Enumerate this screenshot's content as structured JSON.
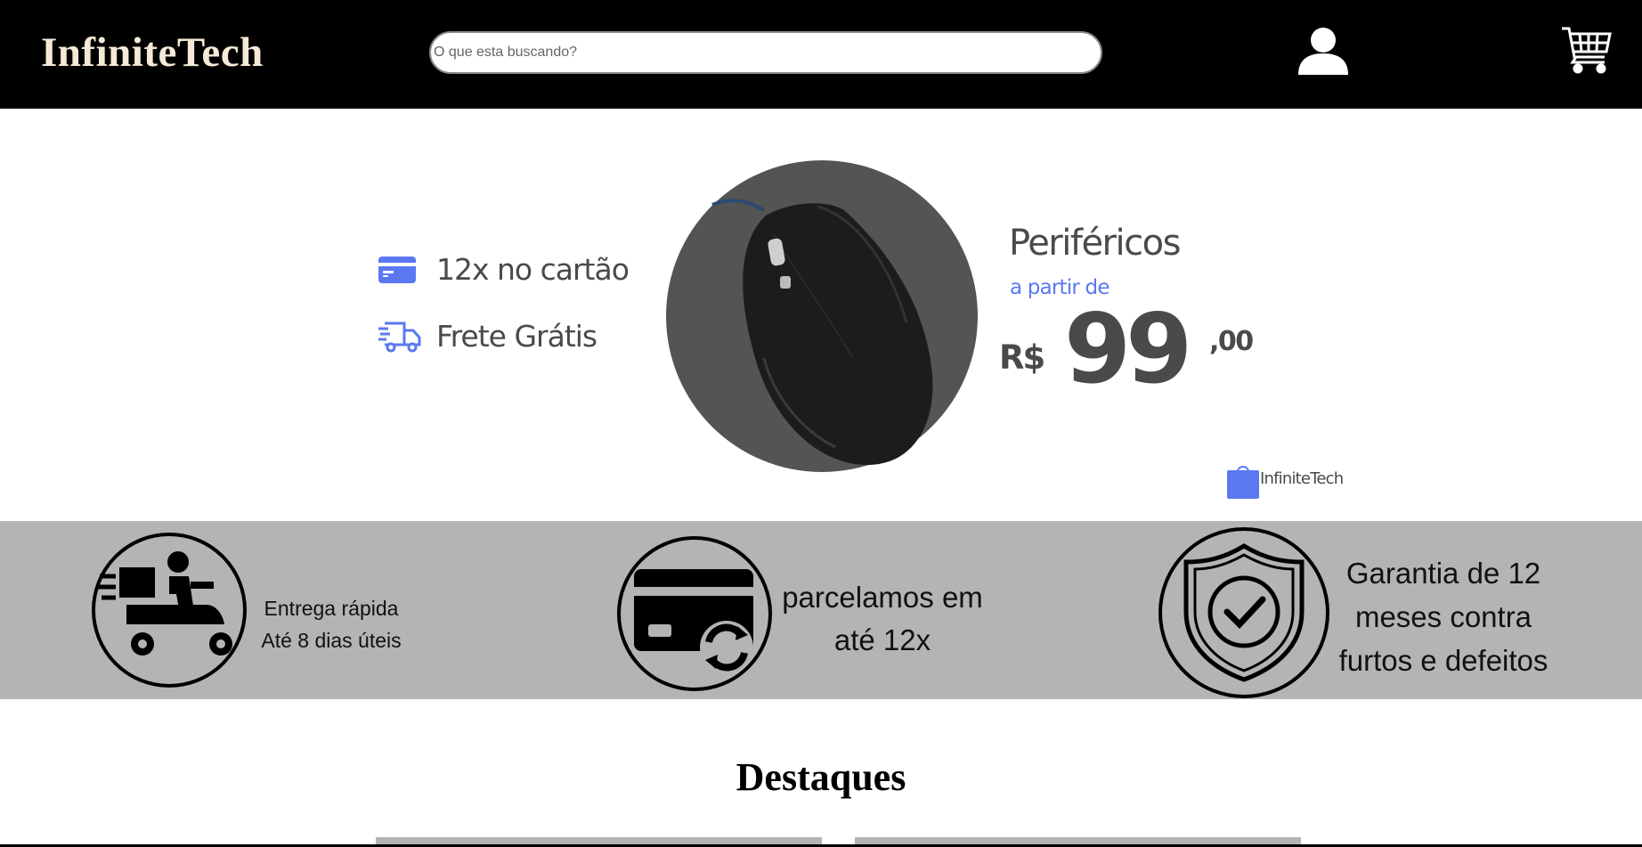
{
  "header": {
    "logo": "InfiniteTech",
    "search_placeholder": "O que esta buscando?",
    "user_icon": "user-icon",
    "cart_icon": "cart-icon"
  },
  "hero": {
    "features": [
      {
        "icon": "credit-card-icon",
        "label": "12x no cartão"
      },
      {
        "icon": "delivery-truck-icon",
        "label": "Frete Grátis"
      }
    ],
    "product_image": "computer-mouse",
    "category": "Periféricos",
    "from_label": "a partir de",
    "currency": "R$",
    "price_integer": "99",
    "price_decimal": ",00",
    "brand_label": "InfiniteTech",
    "accent_color": "#5b78f2"
  },
  "benefits": {
    "items": [
      {
        "icon": "delivery-scooter-icon",
        "line1": "Entrega rápida",
        "line2": "Até 8 dias úteis"
      },
      {
        "icon": "card-refresh-icon",
        "line1": "parcelamos em",
        "line2": "até 12x"
      },
      {
        "icon": "shield-check-icon",
        "line1": "Garantia de 12",
        "line2": "meses contra",
        "line3": "furtos e defeitos"
      }
    ]
  },
  "highlights": {
    "title": "Destaques"
  }
}
